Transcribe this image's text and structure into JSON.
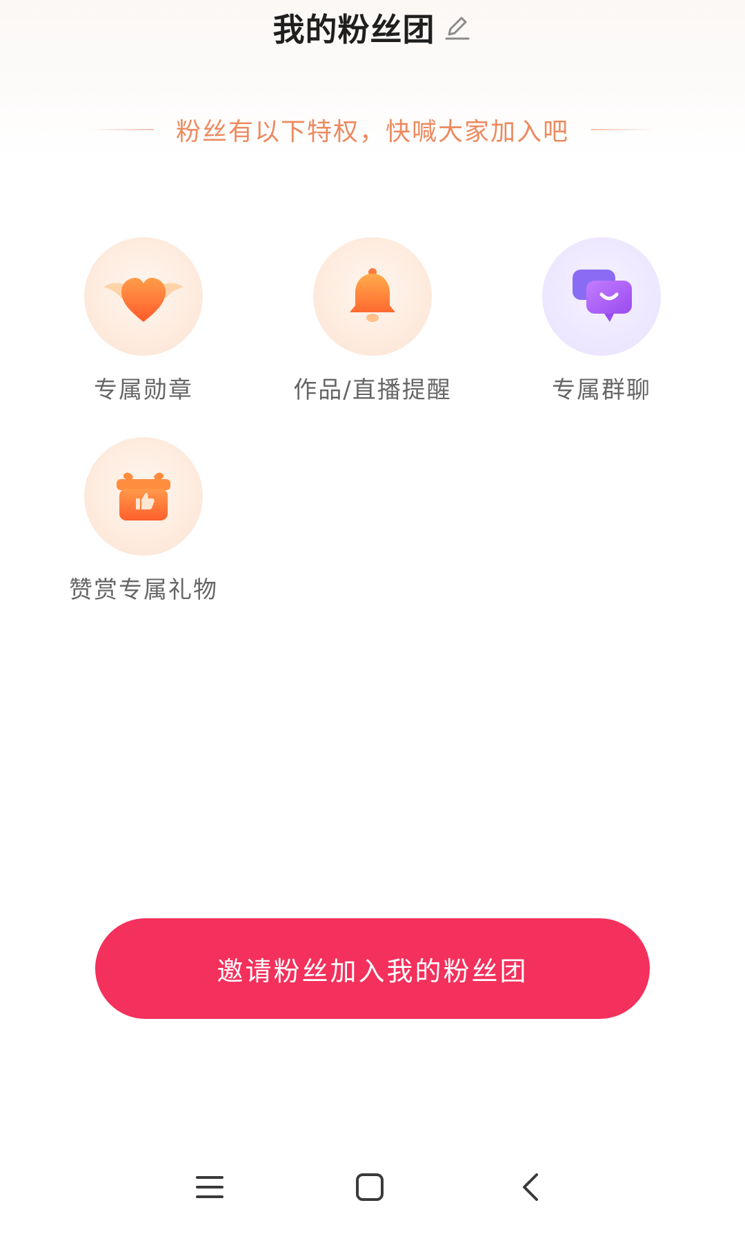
{
  "header": {
    "title": "我的粉丝团",
    "edit_icon": "pencil-icon"
  },
  "subtitle": "粉丝有以下特权，快喊大家加入吧",
  "perks": [
    {
      "label": "专属勋章",
      "icon": "winged-heart-icon"
    },
    {
      "label": "作品/直播提醒",
      "icon": "bell-icon"
    },
    {
      "label": "专属群聊",
      "icon": "chat-bubbles-icon"
    },
    {
      "label": "赞赏专属礼物",
      "icon": "gift-box-icon"
    }
  ],
  "invite_button": {
    "label": "邀请粉丝加入我的粉丝团"
  },
  "nav": {
    "menu_icon": "menu-icon",
    "home_icon": "home-square-icon",
    "back_icon": "back-chevron-icon"
  },
  "colors": {
    "accent": "#f4305c",
    "subtitle": "#ec8a5f",
    "icon_warm": "#ff7a3c",
    "icon_purple": "#a35ef0"
  }
}
